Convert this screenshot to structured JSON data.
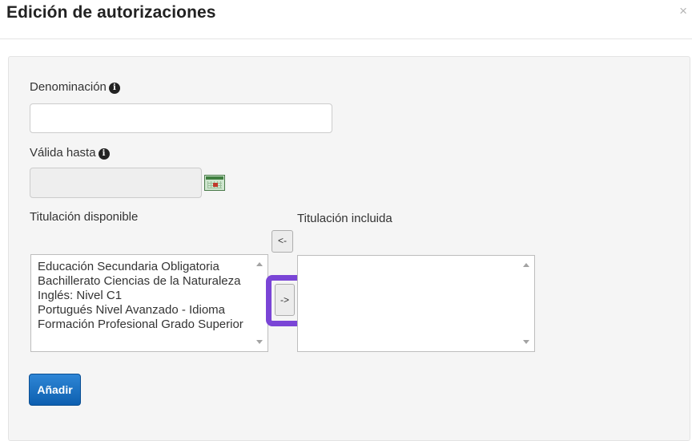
{
  "modal": {
    "title": "Edición de autorizaciones",
    "close_glyph": "×"
  },
  "form": {
    "denominacion": {
      "label": "Denominación",
      "value": "",
      "info_glyph": "i"
    },
    "valida_hasta": {
      "label": "Válida hasta",
      "value": "",
      "info_glyph": "i",
      "calendar_icon": "calendar-icon"
    },
    "titulacion_disponible": {
      "label": "Titulación disponible",
      "items": [
        "Educación Secundaria Obligatoria",
        "Bachillerato Ciencias de la Naturaleza",
        "Inglés: Nivel C1",
        "Portugués Nivel Avanzado - Idioma",
        "Formación Profesional Grado Superior"
      ]
    },
    "titulacion_incluida": {
      "label": "Titulación incluida",
      "items": []
    },
    "move_left_label": "<-",
    "move_right_label": "->",
    "add_button_label": "Añadir"
  },
  "colors": {
    "primary_button": "#1467c2",
    "highlight": "#7a45d6",
    "panel_bg": "#f5f5f5"
  }
}
